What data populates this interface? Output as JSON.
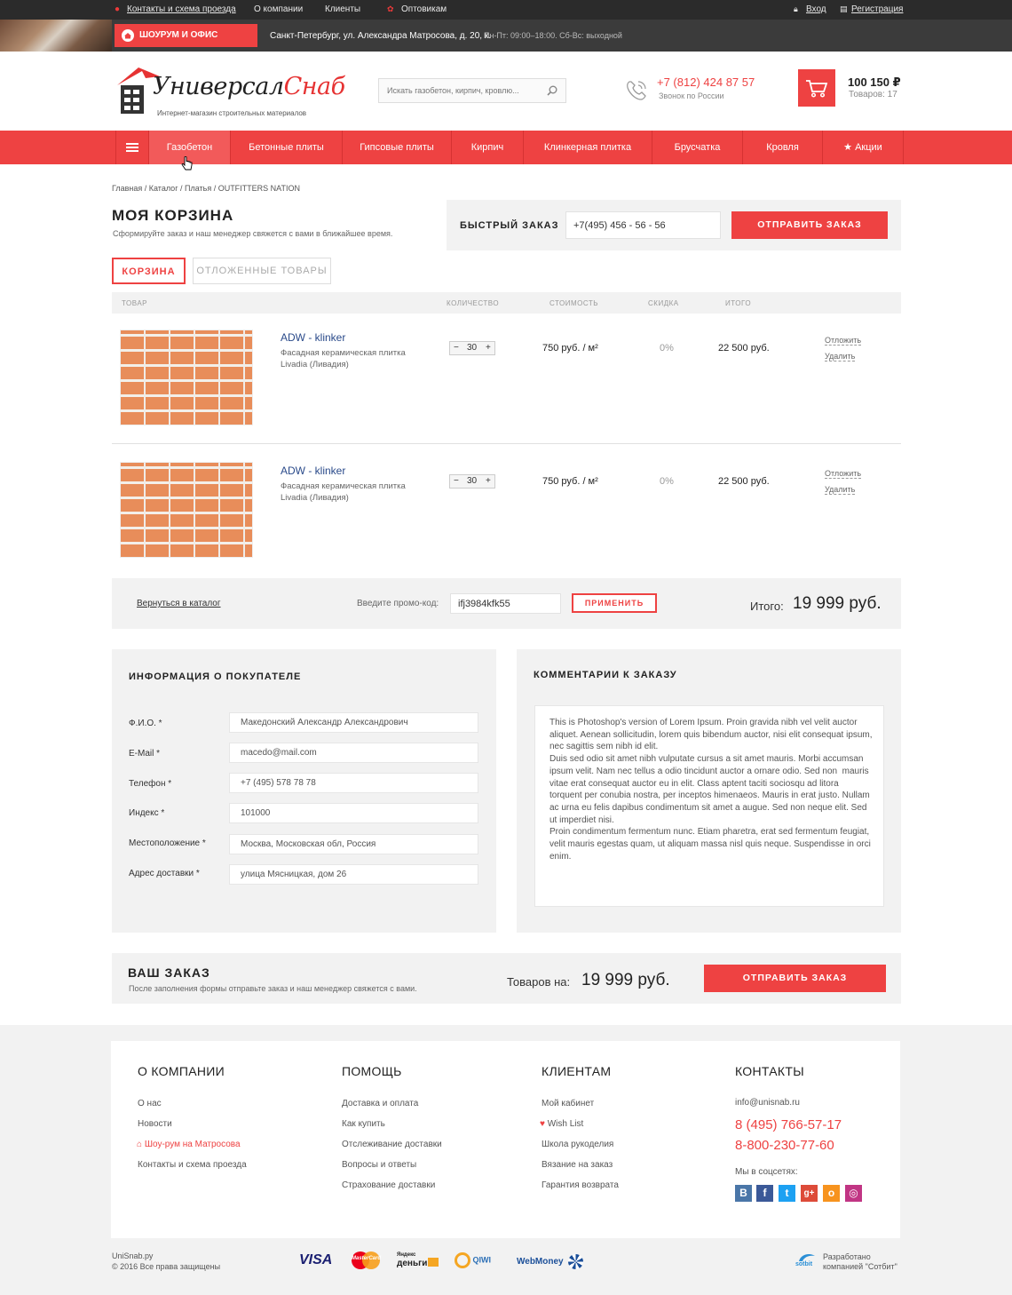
{
  "topbar": {
    "contacts": "Контакты и схема проезда",
    "about": "О компании",
    "clients": "Клиенты",
    "wholesale": "Оптовикам",
    "login": "Вход",
    "register": "Регистрация"
  },
  "infobar": {
    "showroom": "ШОУРУМ И ОФИС ПРОДАЖ",
    "address": "Санкт-Петербург, ул. Александра Матросова, д. 20, к.",
    "hours": "Пн-Пт: 09:00–18:00. Сб-Вс: выходной"
  },
  "header": {
    "logo_main": "Универсал",
    "logo_accent": "Снаб",
    "logo_sub": "Интернет-магазин строительных материалов",
    "search_placeholder": "Искать газобетон, кирпич, кровлю...",
    "phone": "+7 (812) 424 87 57",
    "phone_sub": "Звонок по России",
    "cart_sum": "100 150 ₽",
    "cart_count": "Товаров: 17"
  },
  "nav": [
    "Газобетон",
    "Бетонные плиты",
    "Гипсовые плиты",
    "Кирпич",
    "Клинкерная плитка",
    "Брусчатка",
    "Кровля",
    "Акции"
  ],
  "breadcrumb": "Главная / Каталог / Платья / OUTFITTERS NATION",
  "page": {
    "title": "МОЯ КОРЗИНА",
    "subtitle": "Сформируйте заказ и наш менеджер свяжется с вами в ближайшее время."
  },
  "quick_order": {
    "label": "БЫСТРЫЙ ЗАКАЗ",
    "phone_value": "+7(495) 456 - 56 - 56",
    "button": "ОТПРАВИТЬ ЗАКАЗ"
  },
  "tabs": {
    "cart": "КОРЗИНА",
    "deferred": "ОТЛОЖЕННЫЕ ТОВАРЫ"
  },
  "table_head": {
    "product": "ТОВАР",
    "qty": "КОЛИЧЕСТВО",
    "cost": "СТОИМОСТЬ",
    "discount": "СКИДКА",
    "total": "ИТОГО"
  },
  "items": [
    {
      "name": "ADW - klinker",
      "desc": "Фасадная керамическая плитка Livadia (Ливадия)",
      "qty": "30",
      "price": "750 руб. / м²",
      "discount": "0%",
      "total": "22 500 руб.",
      "defer": "Отложить",
      "remove": "Удалить"
    },
    {
      "name": "ADW - klinker",
      "desc": "Фасадная керамическая плитка Livadia (Ливадия)",
      "qty": "30",
      "price": "750 руб. / м²",
      "discount": "0%",
      "total": "22 500 руб.",
      "defer": "Отложить",
      "remove": "Удалить"
    }
  ],
  "promo": {
    "back": "Вернуться в каталог",
    "label": "Введите промо-код:",
    "code": "ifj3984kfk55",
    "apply": "ПРИМЕНИТЬ",
    "total_label": "Итого:",
    "total_value": "19 999 руб."
  },
  "buyer": {
    "title": "ИНФОРМАЦИЯ О ПОКУПАТЕЛЕ",
    "fields": [
      {
        "label": "Ф.И.О. *",
        "value": "Македонский Александр Александрович"
      },
      {
        "label": "E-Mail *",
        "value": "macedo@mail.com"
      },
      {
        "label": "Телефон *",
        "value": "+7 (495) 578 78 78"
      },
      {
        "label": "Индекс *",
        "value": "101000"
      },
      {
        "label": "Местоположение *",
        "value": "Москва, Московская обл, Россия"
      },
      {
        "label": "Адрес доставки *",
        "value": "улица Мясницкая, дом 26"
      }
    ]
  },
  "comments": {
    "title": "КОММЕНТАРИИ К ЗАКАЗУ",
    "text": "This is Photoshop's version of Lorem Ipsum. Proin gravida nibh vel velit auctor aliquet. Aenean sollicitudin, lorem quis bibendum auctor, nisi elit consequat ipsum, nec sagittis sem nibh id elit.\nDuis sed odio sit amet nibh vulputate cursus a sit amet mauris. Morbi accumsan ipsum velit. Nam nec tellus a odio tincidunt auctor a ornare odio. Sed non  mauris vitae erat consequat auctor eu in elit. Class aptent taciti sociosqu ad litora torquent per conubia nostra, per inceptos himenaeos. Mauris in erat justo. Nullam ac urna eu felis dapibus condimentum sit amet a augue. Sed non neque elit. Sed ut imperdiet nisi.\nProin condimentum fermentum nunc. Etiam pharetra, erat sed fermentum feugiat, velit mauris egestas quam, ut aliquam massa nisl quis neque. Suspendisse in orci enim."
  },
  "order": {
    "title": "ВАШ ЗАКАЗ",
    "subtitle": "После заполнения формы отправьте заказ и наш менеджер свяжется с вами.",
    "label": "Товаров на:",
    "value": "19 999 руб.",
    "button": "ОТПРАВИТЬ ЗАКАЗ"
  },
  "footer": {
    "about": {
      "title": "О КОМПАНИИ",
      "items": [
        "О нас",
        "Новости",
        "Шоу-рум на Матросова",
        "Контакты и схема проезда"
      ]
    },
    "help": {
      "title": "ПОМОЩЬ",
      "items": [
        "Доставка и оплата",
        "Как купить",
        "Отслеживание доставки",
        "Вопросы и ответы",
        "Страхование доставки"
      ]
    },
    "clients": {
      "title": "КЛИЕНТАМ",
      "items": [
        "Мой кабинет",
        "Wish List",
        "Школа рукоделия",
        "Вязание на заказ",
        "Гарантия возврата"
      ]
    },
    "contacts": {
      "title": "КОНТАКТЫ",
      "email": "info@unisnab.ru",
      "phone1": "8 (495) 766-57-17",
      "phone2": "8-800-230-77-60",
      "social_label": "Мы в соцсетях:"
    },
    "copyright_site": "UniSnab.ру",
    "copyright": "© 2016  Все права защищены",
    "payments": {
      "visa": "VISA",
      "mastercard": "MasterCard",
      "yandex": "деньги",
      "yandex_small": "Яндекс",
      "qiwi": "QIWI",
      "webmoney": "WebMoney"
    },
    "dev_logo": "sotbit",
    "developer": "Разработано компанией \"Сотбит\""
  },
  "colors": {
    "accent": "#ee4242",
    "dark": "#2b2b2b",
    "panel": "#f2f2f2"
  }
}
